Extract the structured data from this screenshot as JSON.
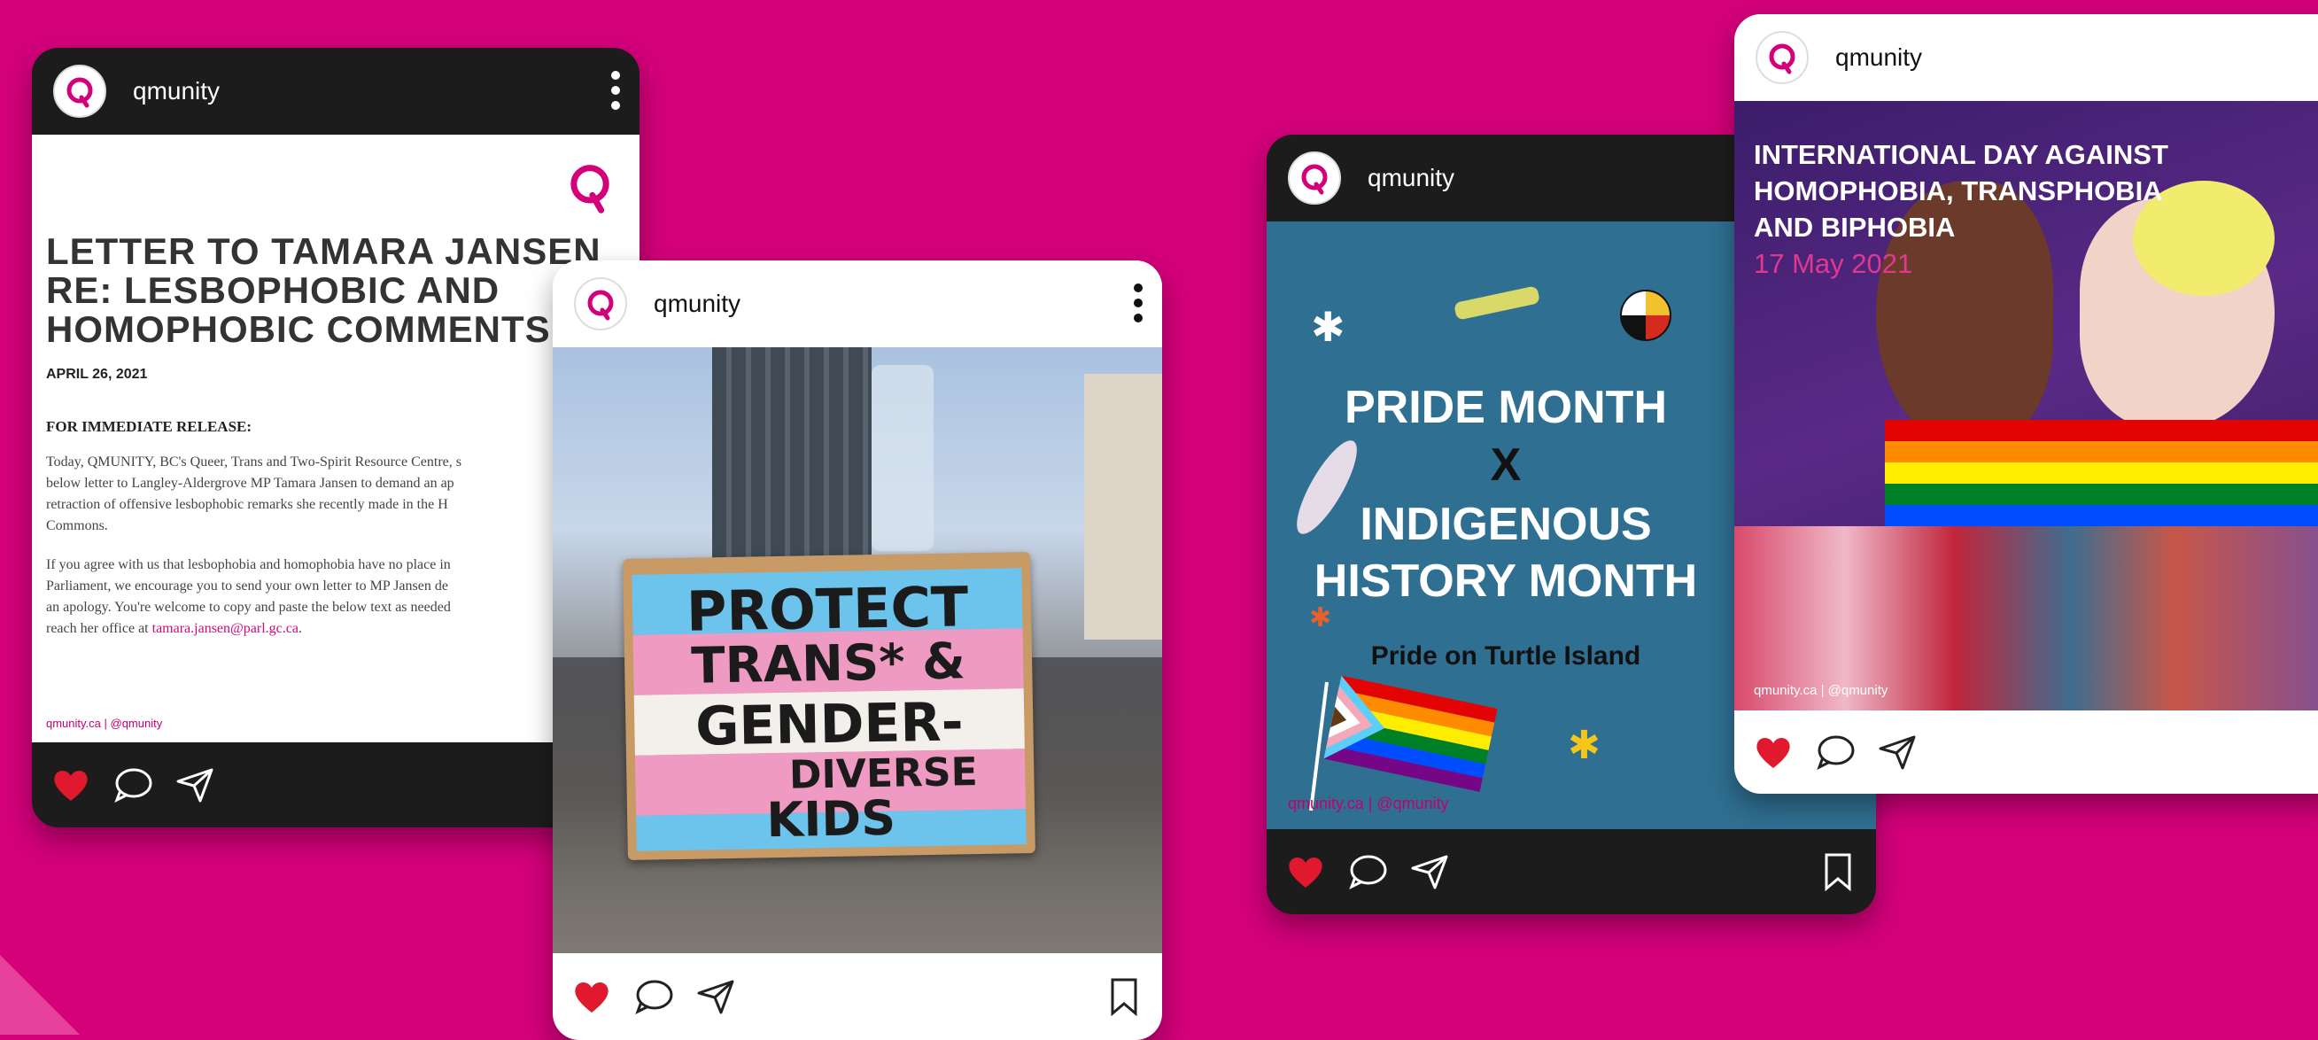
{
  "colors": {
    "background": "#d3007a",
    "accent": "#c2006f"
  },
  "posts": [
    {
      "handle": "qmunity",
      "title_lines": [
        "LETTER TO TAMARA JANSEN",
        "RE: LESBOPHOBIC AND",
        "HOMOPHOBIC COMMENTS"
      ],
      "date": "APRIL 26, 2021",
      "subheading": "FOR IMMEDIATE RELEASE:",
      "para1_lines": [
        "Today, QMUNITY, BC's Queer, Trans and Two-Spirit Resource Centre, s",
        "below letter to Langley-Aldergrove MP Tamara Jansen to demand an ap",
        "retraction of offensive lesbophobic remarks she recently made in the H",
        "Commons."
      ],
      "para2_lines": [
        "If you agree with us that lesbophobia and homophobia have no place in",
        "Parliament, we encourage you to send your own letter to MP Jansen de",
        "an apology. You're welcome to copy and paste the below text as needed"
      ],
      "para2_reach": "reach her office at",
      "email": "tamara.jansen@parl.gc.ca",
      "email_end": ".",
      "footnote": "qmunity.ca | @qmunity"
    },
    {
      "handle": "qmunity",
      "sign_lines": [
        "PROTECT",
        "TRANS* &",
        "GENDER-",
        "DIVERSE",
        "KIDS"
      ]
    },
    {
      "handle": "qmunity",
      "headline_lines": [
        "PRIDE MONTH",
        "X",
        "INDIGENOUS",
        "HISTORY MONTH"
      ],
      "subtitle": "Pride on Turtle Island",
      "footnote": "qmunity.ca | @qmunity"
    },
    {
      "handle": "qmunity",
      "title_lines": [
        "INTERNATIONAL DAY AGAINST",
        "HOMOPHOBIA, TRANSPHOBIA",
        "AND BIPHOBIA"
      ],
      "date": "17 May 2021",
      "footnote": "qmunity.ca | @qmunity"
    }
  ],
  "icons": [
    "qmunity-logo-icon",
    "kebab-menu-icon",
    "heart-icon",
    "comment-icon",
    "share-icon",
    "bookmark-icon"
  ]
}
